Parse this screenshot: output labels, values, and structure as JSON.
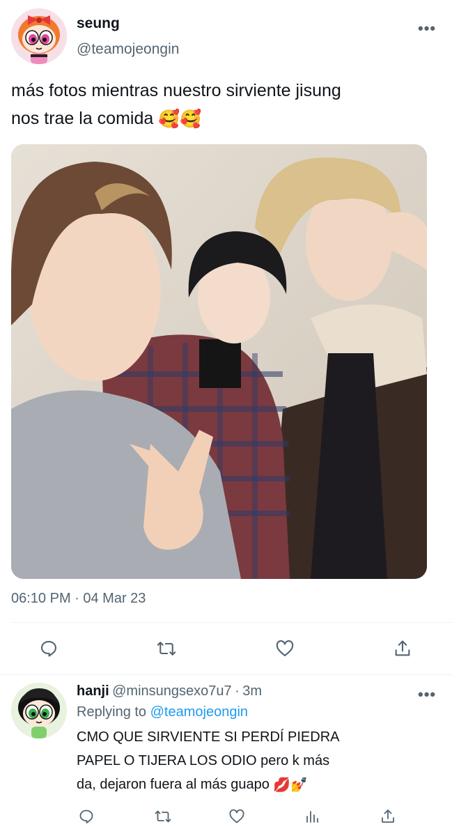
{
  "tweet": {
    "author_name": "seung",
    "author_handle": "@teamojeongin",
    "text_line1": "más fotos mientras nuestro sirviente jisung",
    "text_line2": "nos trae la comida",
    "text_emojis": "🥰🥰",
    "timestamp": "06:10 PM · 04 Mar 23",
    "more_label": "•••",
    "actions": [
      "reply-icon",
      "retweet-icon",
      "like-icon",
      "share-icon"
    ]
  },
  "reply": {
    "author_name": "hanji",
    "author_handle": "@minsungsexo7u7",
    "separator": "·",
    "age": "3m",
    "replying_prefix": "Replying to",
    "replying_to": "@teamojeongin",
    "text_line1": "CMO QUE SIRVIENTE SI PERDÍ PIEDRA",
    "text_line2": "PAPEL O TIJERA LOS ODIO pero k más",
    "text_line3": "da, dejaron fuera al más guapo",
    "text_emojis": "💋💅",
    "more_label": "•••",
    "actions": [
      "reply-icon",
      "retweet-icon",
      "like-icon",
      "analytics-icon",
      "share-icon"
    ]
  },
  "colors": {
    "text": "#0f1419",
    "secondary": "#536471",
    "link": "#1d9bf0",
    "divider": "#eff3f4"
  }
}
